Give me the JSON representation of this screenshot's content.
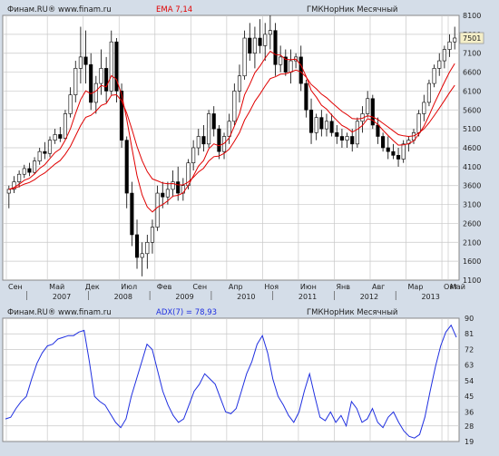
{
  "header": {
    "source_left": "Финам.RU®  www.finam.ru",
    "indicator": "EMA 7,14",
    "instrument": "ГМКНорНик Месячный"
  },
  "lower_header": {
    "source_left": "Финам.RU®  www.finam.ru",
    "indicator": "ADX(7) = 78,93",
    "instrument": "ГМКНорНик Месячный"
  },
  "colors": {
    "background": "#d4dde8",
    "plot_background": "#ffffff",
    "grid": "#c8c8c8",
    "ema": "#e00000",
    "adx": "#1f2fe0",
    "candle_up": "#ffffff",
    "candle_down": "#000000",
    "indicator_label": "#e00000",
    "adx_label": "#1f2fe0",
    "last_price_box": "#f5efc8"
  },
  "chart_data": [
    {
      "type": "candlestick",
      "series_names": [
        "EMA 7",
        "EMA 14"
      ],
      "x_tick_labels": [
        "Сен",
        "Май",
        "Дек",
        "Июл",
        "Фев",
        "Сен",
        "Апр",
        "Ноя",
        "Июн",
        "Янв",
        "Авг",
        "Мар",
        "Окт",
        "Май"
      ],
      "x_year_labels": [
        "2007",
        "2008",
        "2009",
        "2010",
        "2011",
        "2012",
        "2013"
      ],
      "y_ticks": [
        1100,
        1600,
        2100,
        2600,
        3100,
        3600,
        4100,
        4600,
        5100,
        5600,
        6100,
        6600,
        7100,
        7600,
        8100
      ],
      "ylim": [
        1100,
        8100
      ],
      "last_price_label": "7501",
      "last_price": 7501,
      "grid": true,
      "candles": [
        [
          3400,
          3600,
          3000,
          3500
        ],
        [
          3500,
          3850,
          3400,
          3700
        ],
        [
          3700,
          4000,
          3550,
          3900
        ],
        [
          3900,
          4150,
          3800,
          4050
        ],
        [
          4050,
          4200,
          3850,
          3950
        ],
        [
          3950,
          4350,
          3900,
          4250
        ],
        [
          4250,
          4600,
          4150,
          4500
        ],
        [
          4500,
          4750,
          4300,
          4450
        ],
        [
          4450,
          4900,
          4350,
          4800
        ],
        [
          4800,
          5100,
          4700,
          4950
        ],
        [
          4950,
          5150,
          4750,
          4850
        ],
        [
          4850,
          5600,
          4800,
          5500
        ],
        [
          5500,
          6200,
          5400,
          6000
        ],
        [
          6000,
          6900,
          5800,
          6700
        ],
        [
          6700,
          7800,
          6300,
          7000
        ],
        [
          7000,
          7700,
          6300,
          6800
        ],
        [
          6800,
          7100,
          5600,
          5800
        ],
        [
          5800,
          6500,
          5500,
          6300
        ],
        [
          6300,
          7200,
          6000,
          6700
        ],
        [
          6700,
          7000,
          5800,
          6100
        ],
        [
          6100,
          7700,
          6000,
          7400
        ],
        [
          7400,
          7500,
          5800,
          6100
        ],
        [
          6100,
          6300,
          4600,
          4800
        ],
        [
          4800,
          4900,
          3000,
          3400
        ],
        [
          3400,
          3700,
          2000,
          2300
        ],
        [
          2300,
          2700,
          1400,
          1700
        ],
        [
          1700,
          2100,
          1200,
          1800
        ],
        [
          1800,
          2300,
          1400,
          2100
        ],
        [
          2100,
          2700,
          1800,
          2500
        ],
        [
          2500,
          3600,
          2400,
          3400
        ],
        [
          3400,
          3700,
          3000,
          3300
        ],
        [
          3300,
          3700,
          3100,
          3500
        ],
        [
          3500,
          4000,
          3300,
          3700
        ],
        [
          3700,
          4100,
          3200,
          3400
        ],
        [
          3400,
          3800,
          3200,
          3600
        ],
        [
          3600,
          4300,
          3500,
          4200
        ],
        [
          4200,
          4800,
          4000,
          4600
        ],
        [
          4600,
          5100,
          4400,
          4900
        ],
        [
          4900,
          5200,
          4500,
          4700
        ],
        [
          4700,
          5600,
          4600,
          5500
        ],
        [
          5500,
          5700,
          4900,
          5100
        ],
        [
          5100,
          5200,
          4300,
          4500
        ],
        [
          4500,
          5000,
          4300,
          4900
        ],
        [
          4900,
          5500,
          4700,
          5300
        ],
        [
          5300,
          6300,
          5200,
          6100
        ],
        [
          6100,
          6800,
          5800,
          6500
        ],
        [
          6500,
          7700,
          6400,
          7500
        ],
        [
          7500,
          7900,
          6900,
          7100
        ],
        [
          7100,
          7800,
          6700,
          7500
        ],
        [
          7500,
          8000,
          7100,
          7300
        ],
        [
          7300,
          7900,
          6900,
          7600
        ],
        [
          7600,
          8100,
          7200,
          7700
        ],
        [
          7700,
          7900,
          6500,
          6800
        ],
        [
          6800,
          7300,
          6600,
          7000
        ],
        [
          7000,
          7200,
          6500,
          6600
        ],
        [
          6600,
          7200,
          6300,
          6900
        ],
        [
          6900,
          7100,
          6700,
          7000
        ],
        [
          7000,
          7300,
          6100,
          6300
        ],
        [
          6300,
          6400,
          5400,
          5600
        ],
        [
          5600,
          5900,
          4700,
          5000
        ],
        [
          5000,
          5500,
          4800,
          5400
        ],
        [
          5400,
          5600,
          4900,
          5100
        ],
        [
          5100,
          5500,
          4900,
          5300
        ],
        [
          5300,
          5500,
          4900,
          5000
        ],
        [
          5000,
          5200,
          4700,
          4900
        ],
        [
          4900,
          5100,
          4600,
          4800
        ],
        [
          4800,
          5000,
          4600,
          4900
        ],
        [
          4900,
          5100,
          4500,
          4700
        ],
        [
          4700,
          5400,
          4600,
          5300
        ],
        [
          5300,
          5700,
          5000,
          5500
        ],
        [
          5500,
          6100,
          5400,
          5900
        ],
        [
          5900,
          6000,
          5100,
          5200
        ],
        [
          5200,
          5400,
          4700,
          4900
        ],
        [
          4900,
          5000,
          4500,
          4600
        ],
        [
          4600,
          4900,
          4300,
          4500
        ],
        [
          4500,
          4700,
          4300,
          4400
        ],
        [
          4400,
          4600,
          4100,
          4300
        ],
        [
          4300,
          4800,
          4200,
          4700
        ],
        [
          4700,
          4900,
          4500,
          4800
        ],
        [
          4800,
          5100,
          4700,
          5000
        ],
        [
          5000,
          5600,
          4900,
          5500
        ],
        [
          5500,
          6000,
          5300,
          5800
        ],
        [
          5800,
          6400,
          5700,
          6300
        ],
        [
          6300,
          6800,
          6200,
          6700
        ],
        [
          6700,
          7100,
          6500,
          6900
        ],
        [
          6900,
          7300,
          6700,
          7200
        ],
        [
          7200,
          7600,
          7000,
          7400
        ],
        [
          7400,
          7800,
          7200,
          7501
        ]
      ]
    },
    {
      "type": "line",
      "series_names": [
        "ADX(7)"
      ],
      "y_ticks": [
        19,
        28,
        36,
        45,
        54,
        63,
        72,
        81,
        90
      ],
      "ylim": [
        19,
        90
      ],
      "last_value": 78.93,
      "grid": true,
      "values": [
        32,
        33,
        38,
        42,
        45,
        55,
        64,
        70,
        74,
        75,
        78,
        79,
        80,
        80,
        82,
        83,
        65,
        45,
        42,
        40,
        35,
        30,
        27,
        32,
        45,
        55,
        65,
        75,
        72,
        60,
        48,
        40,
        34,
        30,
        32,
        40,
        48,
        52,
        58,
        55,
        52,
        44,
        36,
        35,
        38,
        48,
        58,
        65,
        75,
        80,
        70,
        55,
        45,
        40,
        34,
        30,
        36,
        48,
        58,
        45,
        33,
        31,
        36,
        30,
        34,
        28,
        42,
        38,
        30,
        32,
        38,
        30,
        27,
        33,
        36,
        30,
        25,
        22,
        21,
        23,
        33,
        48,
        62,
        74,
        82,
        86,
        79
      ]
    }
  ]
}
